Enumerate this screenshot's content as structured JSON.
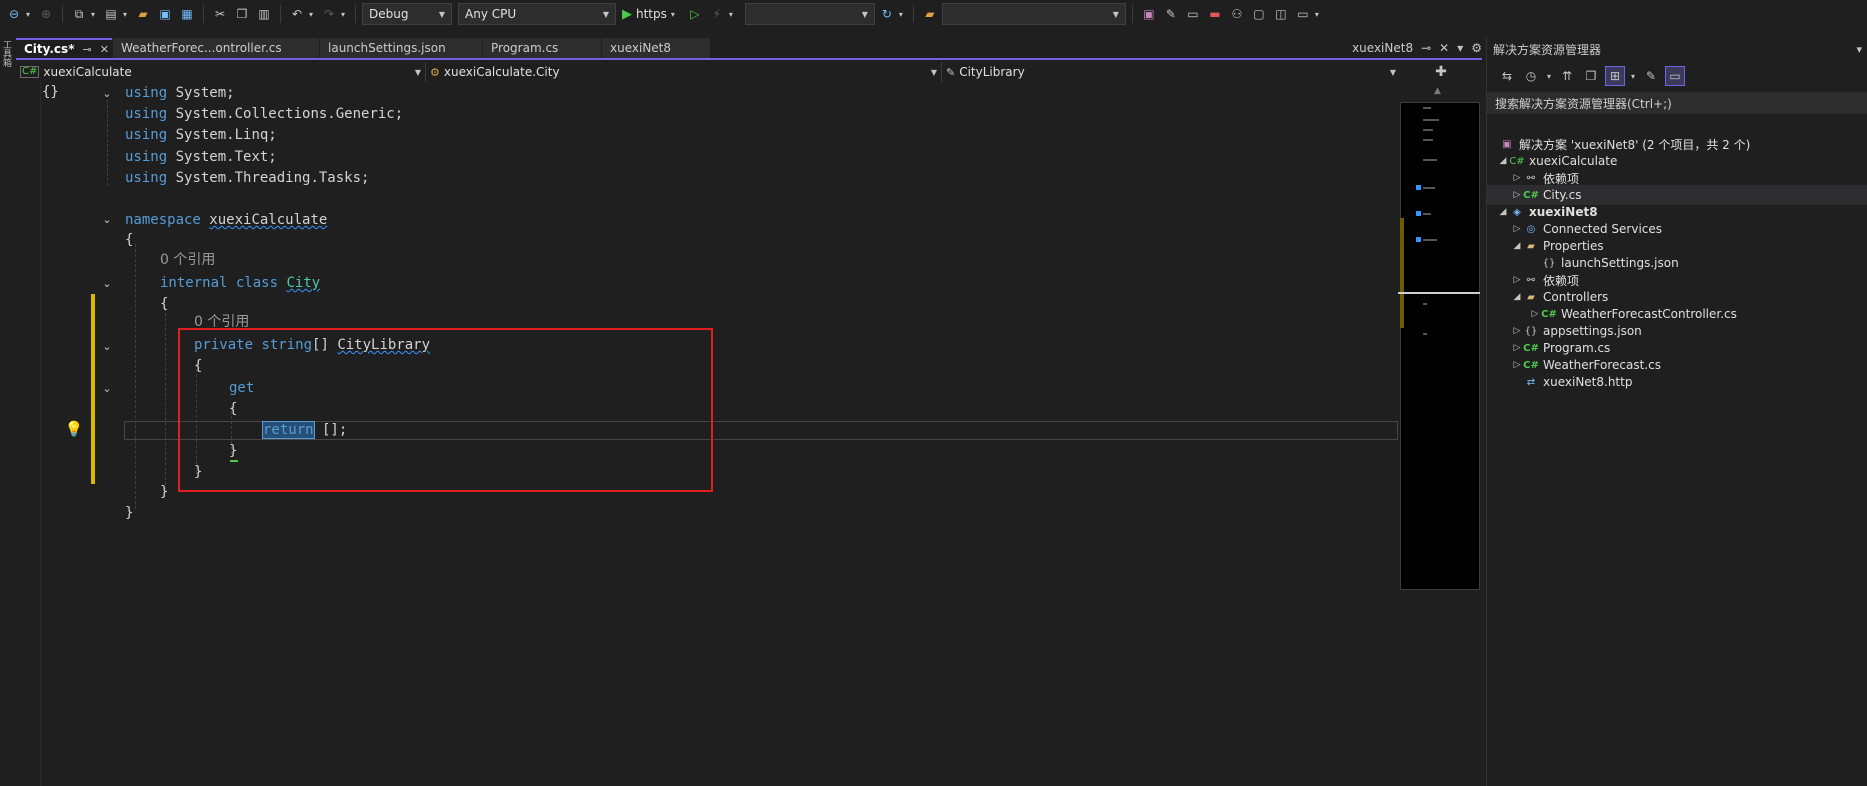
{
  "toolbar": {
    "config": "Debug",
    "platform": "Any CPU",
    "run_label": "https",
    "target_combo": "",
    "search_combo": ""
  },
  "left_strip": {
    "label": "工具箱"
  },
  "tabs": [
    {
      "label": "City.cs*",
      "active": true
    },
    {
      "label": "WeatherForec...ontroller.cs"
    },
    {
      "label": "launchSettings.json"
    },
    {
      "label": "Program.cs"
    },
    {
      "label": "xuexiNet8"
    }
  ],
  "tab_right": {
    "label": "xuexiNet8"
  },
  "nav": {
    "project": "xuexiCalculate",
    "type": "xuexiCalculate.City",
    "member": "CityLibrary"
  },
  "code": {
    "l1_kw": "using",
    "l1_rest": " System;",
    "l2_kw": "using",
    "l2_rest": " System.Collections.Generic;",
    "l3_kw": "using",
    "l3_rest": " System.Linq;",
    "l4_kw": "using",
    "l4_rest": " System.Text;",
    "l5_kw": "using",
    "l5_rest": " System.Threading.Tasks;",
    "ns_kw": "namespace",
    "ns_name": "xuexiCalculate",
    "open_brace": "{",
    "ref1": "0 个引用",
    "class_kw1": "internal",
    "class_kw2": "class",
    "class_name": "City",
    "ref2": "0 个引用",
    "prop_kw": "private",
    "prop_type": "string",
    "prop_arr": "[] ",
    "prop_name": "CityLibrary",
    "get_kw": "get",
    "return_kw": "return",
    "return_rest": " [];",
    "close_brace": "}"
  },
  "solution_explorer": {
    "title": "解决方案资源管理器",
    "search_placeholder": "搜索解决方案资源管理器(Ctrl+;)",
    "items": [
      {
        "label": "解决方案 'xuexiNet8' (2 个项目，共 2 个)"
      },
      {
        "label": "xuexiCalculate"
      },
      {
        "label": "依赖项"
      },
      {
        "label": "City.cs"
      },
      {
        "label": "xuexiNet8"
      },
      {
        "label": "Connected Services"
      },
      {
        "label": "Properties"
      },
      {
        "label": "launchSettings.json"
      },
      {
        "label": "依赖项"
      },
      {
        "label": "Controllers"
      },
      {
        "label": "WeatherForecastController.cs"
      },
      {
        "label": "appsettings.json"
      },
      {
        "label": "Program.cs"
      },
      {
        "label": "WeatherForecast.cs"
      },
      {
        "label": "xuexiNet8.http"
      }
    ]
  },
  "colors": {
    "accent": "#7160e8",
    "keyword": "#569cd6",
    "type": "#4ec9b0",
    "highlight_box": "#e02020",
    "change_bar": "#d7ba00"
  }
}
